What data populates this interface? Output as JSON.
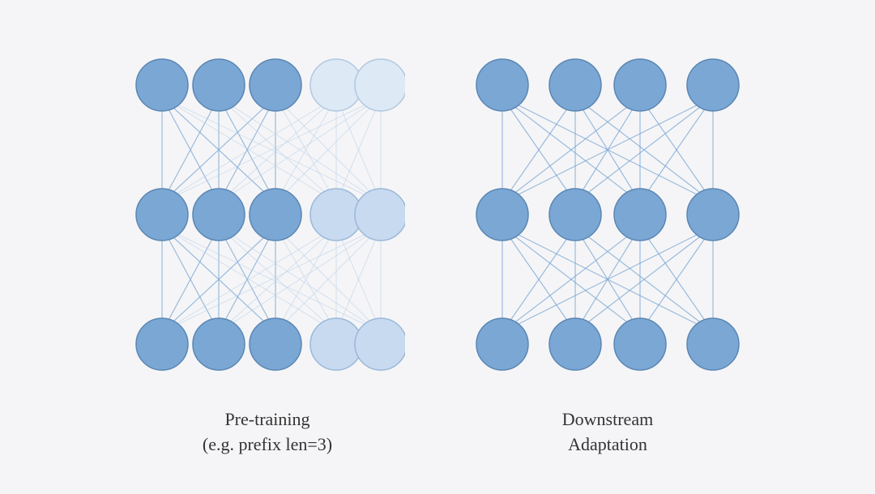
{
  "diagrams": [
    {
      "id": "pre-training",
      "caption_line1": "Pre-training",
      "caption_line2": "(e.g. prefix len=3)",
      "node_color_dark": "#7ba7d4",
      "node_color_light": "#c5d8ee",
      "node_stroke": "#6a96c3"
    },
    {
      "id": "downstream",
      "caption_line1": "Downstream",
      "caption_line2": "Adaptation",
      "node_color_dark": "#7ba7d4",
      "node_color_light": "#7ba7d4",
      "node_stroke": "#6a96c3"
    }
  ]
}
